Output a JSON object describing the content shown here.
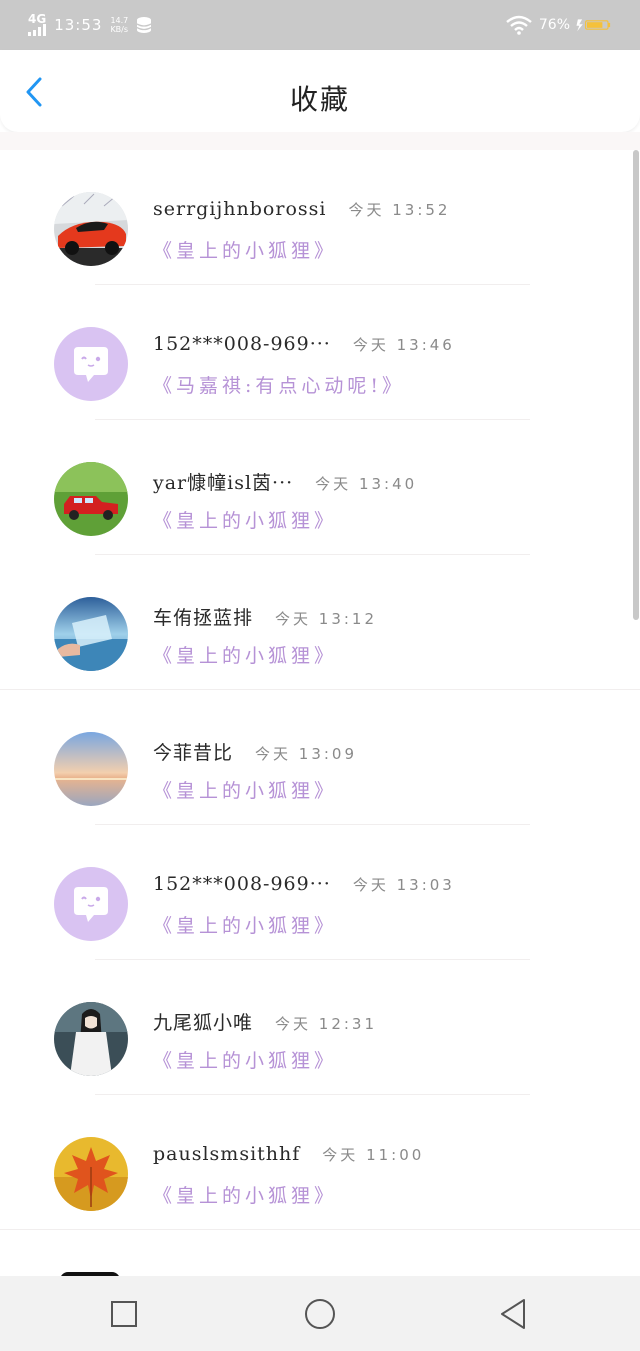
{
  "status_bar": {
    "network": "4G",
    "time": "13:53",
    "speed_value": "14.7",
    "speed_unit": "KB/s",
    "battery": "76%"
  },
  "header": {
    "title": "收藏"
  },
  "items": [
    {
      "name": "serrgijhnborossi",
      "time": "今天 13:52",
      "content": "《皇上的小狐狸》",
      "avatar": "car-red-avatar"
    },
    {
      "name": "152***008-969···",
      "time": "今天 13:46",
      "content": "《马嘉祺:有点心动呢!》",
      "avatar": "chat-bubble-avatar"
    },
    {
      "name": "yar慷幢isl茵···",
      "time": "今天 13:40",
      "content": "《皇上的小狐狸》",
      "avatar": "toy-car-avatar"
    },
    {
      "name": "车侑拯蓝排",
      "time": "今天 13:12",
      "content": "《皇上的小狐狸》",
      "avatar": "bottle-sea-avatar"
    },
    {
      "name": "今菲昔比",
      "time": "今天 13:09",
      "content": "《皇上的小狐狸》",
      "avatar": "sunset-avatar"
    },
    {
      "name": "152***008-969···",
      "time": "今天 13:03",
      "content": "《皇上的小狐狸》",
      "avatar": "chat-bubble-avatar"
    },
    {
      "name": "九尾狐小唯",
      "time": "今天 12:31",
      "content": "《皇上的小狐狸》",
      "avatar": "person-avatar"
    },
    {
      "name": "pauslsmsithhf",
      "time": "今天 11:00",
      "content": "《皇上的小狐狸》",
      "avatar": "maple-leaf-avatar"
    }
  ],
  "colors": {
    "accent": "#2196f3",
    "content": "#b692d6",
    "default_avatar": "#d9c3f2"
  }
}
